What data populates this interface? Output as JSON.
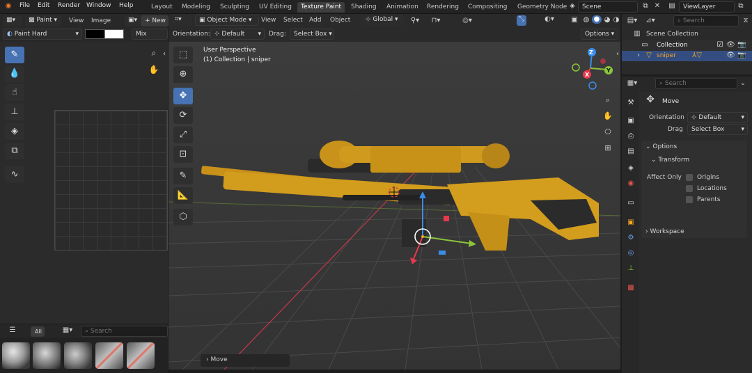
{
  "top_menu": [
    "File",
    "Edit",
    "Render",
    "Window",
    "Help"
  ],
  "workspace_tabs": [
    "Layout",
    "Modeling",
    "Sculpting",
    "UV Editing",
    "Texture Paint",
    "Shading",
    "Animation",
    "Rendering",
    "Compositing",
    "Geometry Node"
  ],
  "active_tab": "Texture Paint",
  "scene": {
    "name": "Scene",
    "view_layer": "ViewLayer"
  },
  "image_editor": {
    "mode": "Paint",
    "view": "View",
    "image": "Image",
    "new_label": "New",
    "brush_name": "Paint Hard",
    "blend": "Mix",
    "search_placeholder": "Search",
    "all_label": "All"
  },
  "viewport": {
    "mode": "Object Mode",
    "menus": [
      "View",
      "Select",
      "Add",
      "Object"
    ],
    "transform": "Global",
    "orientation_label": "Orientation:",
    "orientation_value": "Default",
    "drag_label": "Drag:",
    "drag_value": "Select Box",
    "options": "Options",
    "perspective": "User Perspective",
    "collection_info": "(1) Collection | sniper",
    "last_op": "Move",
    "axis": {
      "x": "X",
      "y": "Y",
      "z": "Z"
    }
  },
  "outliner": {
    "search_placeholder": "Search",
    "scene_collection": "Scene Collection",
    "collection": "Collection",
    "object": "sniper"
  },
  "properties": {
    "search_placeholder": "Search",
    "tool": "Move",
    "orientation_label": "Orientation",
    "orientation_value": "Default",
    "drag_label": "Drag",
    "drag_value": "Select Box",
    "options": "Options",
    "transform": "Transform",
    "affect_only": "Affect Only",
    "origins": "Origins",
    "locations": "Locations",
    "parents": "Parents",
    "workspace": "Workspace"
  },
  "colors": {
    "accent": "#4772b3",
    "rifle_yellow": "#d9a21b",
    "x_axis": "#e8394b",
    "y_axis": "#8bc53a",
    "z_axis": "#3b8de8"
  }
}
